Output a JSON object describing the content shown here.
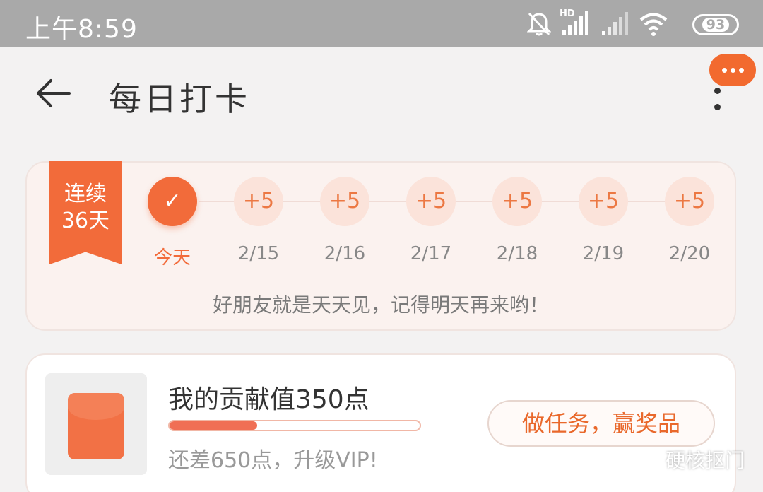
{
  "status_bar": {
    "time": "上午8:59",
    "network_label": "HD",
    "battery": "93",
    "icons": [
      "mute-bell-icon",
      "signal-hd-icon",
      "signal-icon",
      "wifi-icon",
      "battery-icon"
    ]
  },
  "header": {
    "title": "每日打卡",
    "back_icon": "arrow-left-icon",
    "more_badge_icon": "ellipsis-icon",
    "kebab_icon": "more-vertical-icon"
  },
  "checkin": {
    "streak_line1": "连续",
    "streak_line2": "36天",
    "days": [
      {
        "value": "✓",
        "label": "今天",
        "checked": true
      },
      {
        "value": "+5",
        "label": "2/15",
        "checked": false
      },
      {
        "value": "+5",
        "label": "2/16",
        "checked": false
      },
      {
        "value": "+5",
        "label": "2/17",
        "checked": false
      },
      {
        "value": "+5",
        "label": "2/18",
        "checked": false
      },
      {
        "value": "+5",
        "label": "2/19",
        "checked": false
      },
      {
        "value": "+5",
        "label": "2/20",
        "checked": false
      }
    ],
    "message": "好朋友就是天天见，记得明天再来哟！"
  },
  "contribution": {
    "title": "我的贡献值350点",
    "progress_fraction": 0.35,
    "subtitle": "还差650点，升级VIP!",
    "button_label": "做任务，赢奖品"
  },
  "watermark": {
    "text": "硬核抠门",
    "icon": "wechat-icon"
  },
  "colors": {
    "accent": "#f26b3a",
    "status_bar": "#a9a9a9",
    "background": "#f3f2f2"
  }
}
